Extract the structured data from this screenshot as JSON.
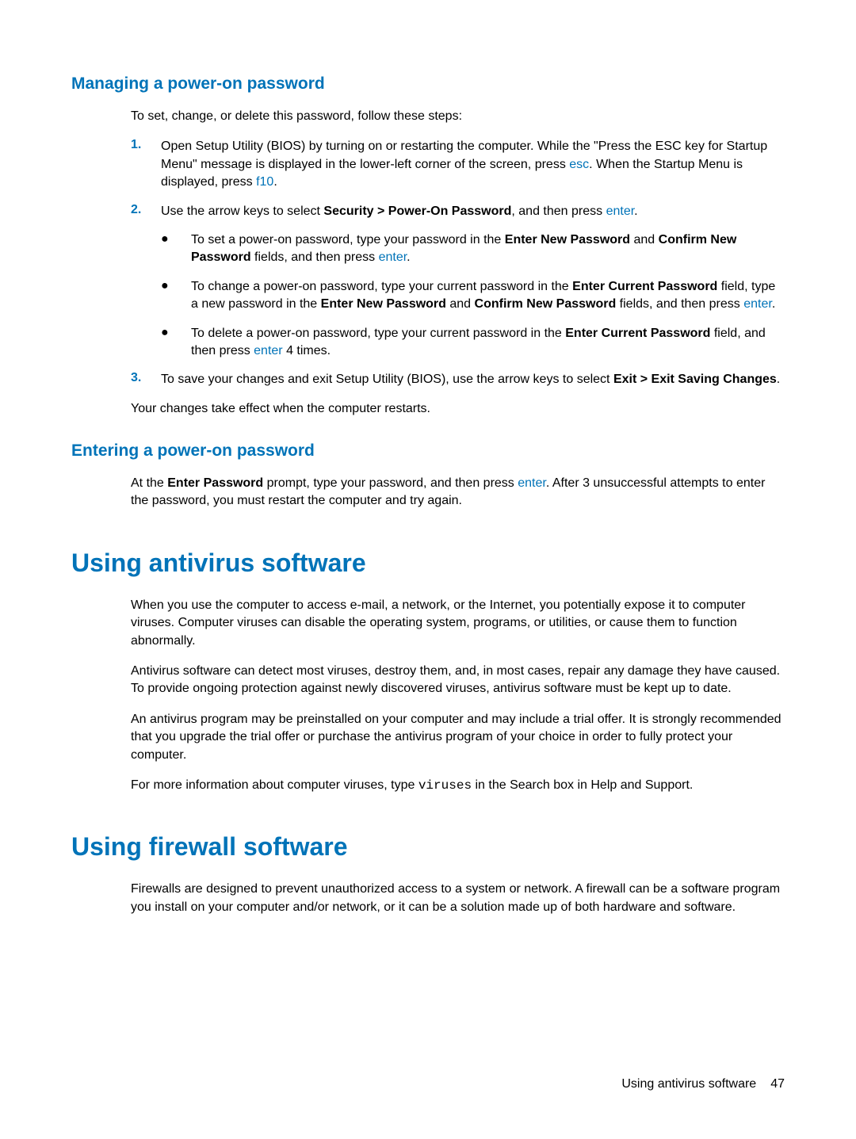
{
  "headings": {
    "h2_managing": "Managing a power-on password",
    "h2_entering": "Entering a power-on password",
    "h1_antivirus": "Using antivirus software",
    "h1_firewall": "Using firewall software"
  },
  "intro_managing": "To set, change, or delete this password, follow these steps:",
  "steps": {
    "n1": "1.",
    "n2": "2.",
    "n3": "3.",
    "bullet": "●"
  },
  "step1": {
    "part1": "Open Setup Utility (BIOS) by turning on or restarting the computer. While the \"Press the ESC key for Startup Menu\" message is displayed in the lower-left corner of the screen, press ",
    "esc": "esc",
    "part2": ". When the Startup Menu is displayed, press ",
    "f10": "f10",
    "part3": "."
  },
  "step2": {
    "part1": "Use the arrow keys to select ",
    "bold1": "Security > Power-On Password",
    "part2": ", and then press ",
    "enter": "enter",
    "part3": "."
  },
  "bullet_set": {
    "part1": "To set a power-on password, type your password in the ",
    "bold1": "Enter New Password",
    "part2": " and ",
    "bold2": "Confirm New Password",
    "part3": " fields, and then press ",
    "enter": "enter",
    "part4": "."
  },
  "bullet_change": {
    "part1": "To change a power-on password, type your current password in the ",
    "bold1": "Enter Current Password",
    "part2": " field, type a new password in the ",
    "bold2": "Enter New Password",
    "part3": " and ",
    "bold3": "Confirm New Password",
    "part4": " fields, and then press ",
    "enter": "enter",
    "part5": "."
  },
  "bullet_delete": {
    "part1": "To delete a power-on password, type your current password in the ",
    "bold1": "Enter Current Password",
    "part2": " field, and then press ",
    "enter": "enter",
    "part3": " 4 times."
  },
  "step3": {
    "part1": "To save your changes and exit Setup Utility (BIOS), use the arrow keys to select ",
    "bold1": "Exit > Exit Saving Changes",
    "part2": "."
  },
  "closing_managing": "Your changes take effect when the computer restarts.",
  "entering_para": {
    "part1": "At the ",
    "bold1": "Enter Password",
    "part2": " prompt, type your password, and then press ",
    "enter": "enter",
    "part3": ". After 3 unsuccessful attempts to enter the password, you must restart the computer and try again."
  },
  "antivirus_p1": "When you use the computer to access e-mail, a network, or the Internet, you potentially expose it to computer viruses. Computer viruses can disable the operating system, programs, or utilities, or cause them to function abnormally.",
  "antivirus_p2": "Antivirus software can detect most viruses, destroy them, and, in most cases, repair any damage they have caused. To provide ongoing protection against newly discovered viruses, antivirus software must be kept up to date.",
  "antivirus_p3": "An antivirus program may be preinstalled on your computer and may include a trial offer. It is strongly recommended that you upgrade the trial offer or purchase the antivirus program of your choice in order to fully protect your computer.",
  "antivirus_p4": {
    "part1": "For more information about computer viruses, type ",
    "mono": "viruses",
    "part2": " in the Search box in Help and Support."
  },
  "firewall_p1": "Firewalls are designed to prevent unauthorized access to a system or network. A firewall can be a software program you install on your computer and/or network, or it can be a solution made up of both hardware and software.",
  "footer": {
    "label": "Using antivirus software",
    "page": "47"
  }
}
